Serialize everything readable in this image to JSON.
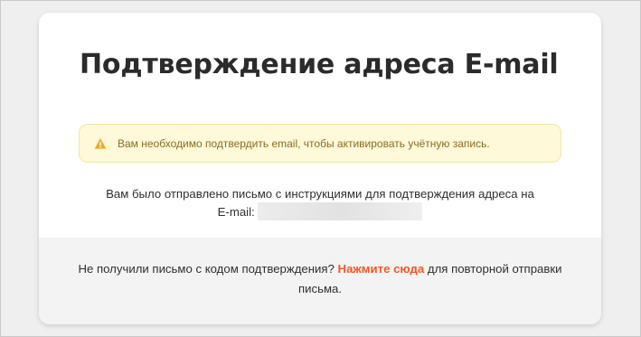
{
  "page": {
    "title": "Подтверждение адреса E-mail"
  },
  "alert": {
    "icon": "warning-icon",
    "text": "Вам необходимо подтвердить email, чтобы активировать учётную запись.",
    "color": "#8c6d1c",
    "background": "#fdf9d9"
  },
  "info": {
    "line1": "Вам было отправлено письмо с инструкциями для подтверждения адреса на",
    "email_prefix": "E-mail:"
  },
  "footer": {
    "text_before": "Не получили письмо с кодом подтверждения?",
    "link_label": "Нажмите сюда",
    "text_after": "для повторной отправки письма.",
    "link_color": "#f05a22"
  }
}
